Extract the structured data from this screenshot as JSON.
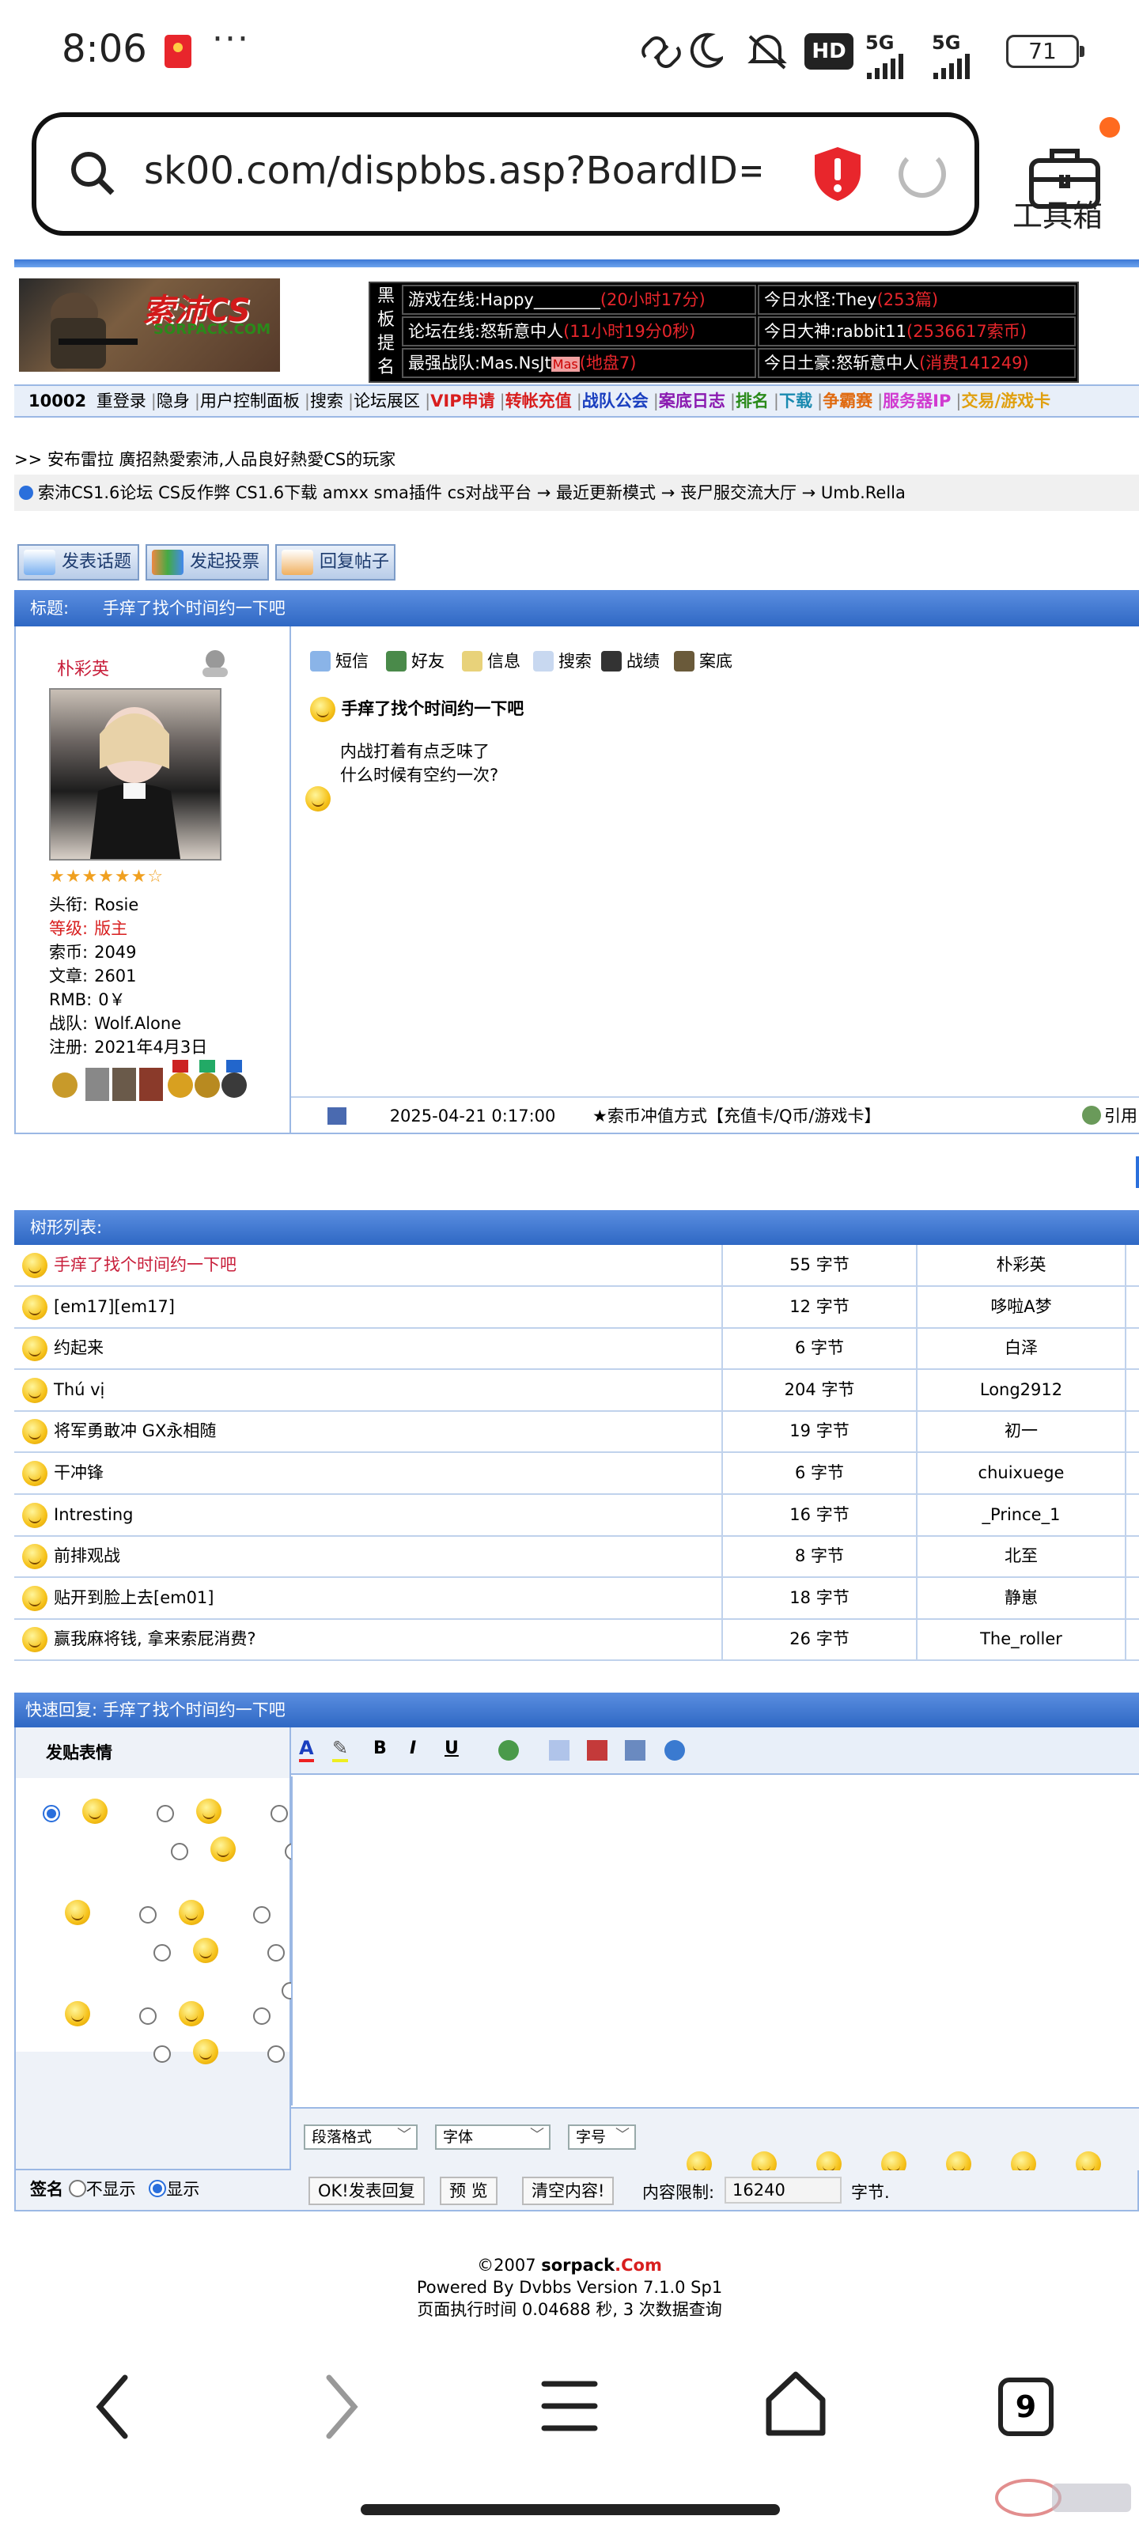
{
  "status_bar": {
    "time": "8:06",
    "more": "···",
    "hd_label": "HD",
    "signal1": "5G",
    "signal2": "5G",
    "battery": "71"
  },
  "browser": {
    "url": "sk00.com/dispbbs.asp?BoardID=...",
    "toolbox_label": "工具箱"
  },
  "site": {
    "logo_text": "索沛CS",
    "logo_sub": "SORPACK.COM",
    "board_side": [
      "黑",
      "板",
      "提",
      "名"
    ],
    "board": [
      {
        "label": "游戏在线:Happy________",
        "red": "(20小时17分)"
      },
      {
        "label": "今日水怪:They",
        "red": "(253篇)"
      },
      {
        "label": "论坛在线:怒斩意中人",
        "red": "(11小时19分0秒)"
      },
      {
        "label": "今日大神:rabbit11",
        "red": "(2536617索币)"
      },
      {
        "label": "最强战队:Mas.NsJt",
        "tag": "Mas",
        "red": "(地盘7)"
      },
      {
        "label": "今日土豪:怒斩意中人",
        "red": "(消费141249)"
      }
    ],
    "nav_user": "10002",
    "nav": [
      {
        "label": "重登录",
        "color": "#000000"
      },
      {
        "label": "隐身",
        "color": "#000000"
      },
      {
        "label": "用户控制面板",
        "color": "#000000"
      },
      {
        "label": "搜索",
        "color": "#000000"
      },
      {
        "label": "论坛展区",
        "color": "#000000"
      },
      {
        "label": "VIP申请",
        "color": "#d81e1e"
      },
      {
        "label": "转帐充值",
        "color": "#d81e1e"
      },
      {
        "label": "战队公会",
        "color": "#1a3fbf"
      },
      {
        "label": "案底日志",
        "color": "#8a1ab0"
      },
      {
        "label": "排名",
        "color": "#2a8a1a"
      },
      {
        "label": "下载",
        "color": "#1a8ab0"
      },
      {
        "label": "争霸赛",
        "color": "#e06a10"
      },
      {
        "label": "服务器IP",
        "color": "#d03ad0"
      },
      {
        "label": "交易/游戏卡",
        "color": "#e0a010"
      }
    ],
    "announce": ">> 安布雷拉 廣招熱愛索沛,人品良好熱愛CS的玩家",
    "breadcrumb": "索沛CS1.6论坛 CS反作弊 CS1.6下载 amxx sma插件 cs对战平台 → 最近更新模式 → 丧尸服交流大厅 → Umb.Rella",
    "buttons": [
      "发表话题",
      "发起投票",
      "回复帖子"
    ]
  },
  "post": {
    "header_label": "标题:",
    "title": "手痒了找个时间约一下吧",
    "author": "朴彩英",
    "stars": "★★★★★★☆",
    "info": [
      {
        "label": "头衔:",
        "value": "Rosie",
        "red": false
      },
      {
        "label": "等级:",
        "value": "版主",
        "red": true
      },
      {
        "label": "索币:",
        "value": "2049",
        "red": false
      },
      {
        "label": "文章:",
        "value": "2601",
        "red": false
      },
      {
        "label": "RMB:",
        "value": "0￥",
        "red": false
      },
      {
        "label": "战队:",
        "value": "Wolf.Alone",
        "red": false
      },
      {
        "label": "注册:",
        "value": "2021年4月3日",
        "red": false
      }
    ],
    "tools": [
      "短信",
      "好友",
      "信息",
      "搜索",
      "战绩",
      "案底"
    ],
    "body_title": "手痒了找个时间约一下吧",
    "body_line1": "内战打着有点乏味了",
    "body_line2": "什么时候有空约一次?",
    "date": "2025-04-21 0:17:00",
    "recharge": "★索币冲值方式【充值卡/Q币/游戏卡】",
    "quote": "引用"
  },
  "tree": {
    "header": "树形列表:",
    "rows": [
      {
        "title": "手痒了找个时间约一下吧",
        "size": "55 字节",
        "author": "朴彩英",
        "active": true
      },
      {
        "title": "[em17][em17]",
        "size": "12 字节",
        "author": "哆啦A梦",
        "active": false
      },
      {
        "title": "约起来",
        "size": "6 字节",
        "author": "白泽",
        "active": false
      },
      {
        "title": "Thú vị",
        "size": "204 字节",
        "author": "Long2912",
        "active": false
      },
      {
        "title": "将军勇敢冲 GX永相随",
        "size": "19 字节",
        "author": "初一",
        "active": false
      },
      {
        "title": "干冲锋",
        "size": "6 字节",
        "author": "chuixuege",
        "active": false
      },
      {
        "title": "Intresting",
        "size": "16 字节",
        "author": "_Prince_1",
        "active": false
      },
      {
        "title": "前排观战",
        "size": "8 字节",
        "author": "北至",
        "active": false
      },
      {
        "title": "贴开到脸上去[em01]",
        "size": "18 字节",
        "author": "静崽",
        "active": false
      },
      {
        "title": "赢我麻将钱, 拿来索屁消费?",
        "size": "26 字节",
        "author": "The_roller",
        "active": false
      }
    ]
  },
  "reply": {
    "header": "快速回复: 手痒了找个时间约一下吧",
    "emo_title": "发贴表情",
    "toolbar": [
      "A",
      "✎",
      "B",
      "I",
      "U"
    ],
    "select_para": "段落格式",
    "select_font": "字体",
    "select_size": "字号",
    "sign_label": "签名",
    "no_show": "不显示",
    "show": "显示",
    "submit": "OK!发表回复",
    "preview": "预 览",
    "clear": "清空内容!",
    "limit_label": "内容限制:",
    "limit_value": "16240",
    "limit_unit": "字节."
  },
  "footer": {
    "copy_prefix": "©2007 ",
    "copy_brand": "sorpack",
    "copy_com": ".Com",
    "powered": "Powered By Dvbbs Version 7.1.0 Sp1",
    "exec": "页面执行时间 0.04688 秒, 3 次数据查询"
  },
  "system_nav": {
    "tab_count": "9"
  },
  "colors": {
    "header_blue": "#2f68c4",
    "link_red": "#c81e3a",
    "brand_red": "#d81e1e"
  }
}
